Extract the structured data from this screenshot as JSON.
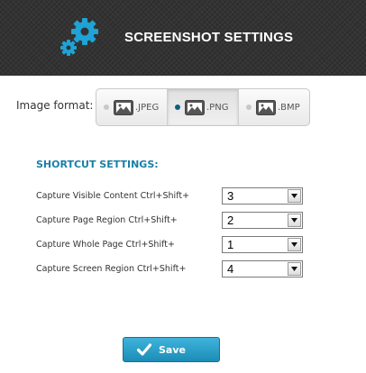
{
  "header": {
    "title": "SCREENSHOT SETTINGS",
    "icon": "gears-icon",
    "accent_color": "#1fa3d6"
  },
  "image_format": {
    "label": "Image format:",
    "selected": "PNG",
    "options": [
      {
        "label": ".JPEG",
        "icon": "image-icon"
      },
      {
        "label": ".PNG",
        "icon": "image-icon"
      },
      {
        "label": ".BMP",
        "icon": "image-icon"
      }
    ]
  },
  "shortcuts": {
    "title": "SHORTCUT SETTINGS:",
    "rows": [
      {
        "label": "Capture Visible Content Ctrl+Shift+",
        "value": "3"
      },
      {
        "label": "Capture Page Region Ctrl+Shift+",
        "value": "2"
      },
      {
        "label": "Capture Whole Page Ctrl+Shift+",
        "value": "1"
      },
      {
        "label": "Capture Screen Region Ctrl+Shift+",
        "value": "4"
      }
    ]
  },
  "save_button": {
    "label": "Save",
    "icon": "checkmark-icon",
    "color": "#2aa3cf"
  }
}
